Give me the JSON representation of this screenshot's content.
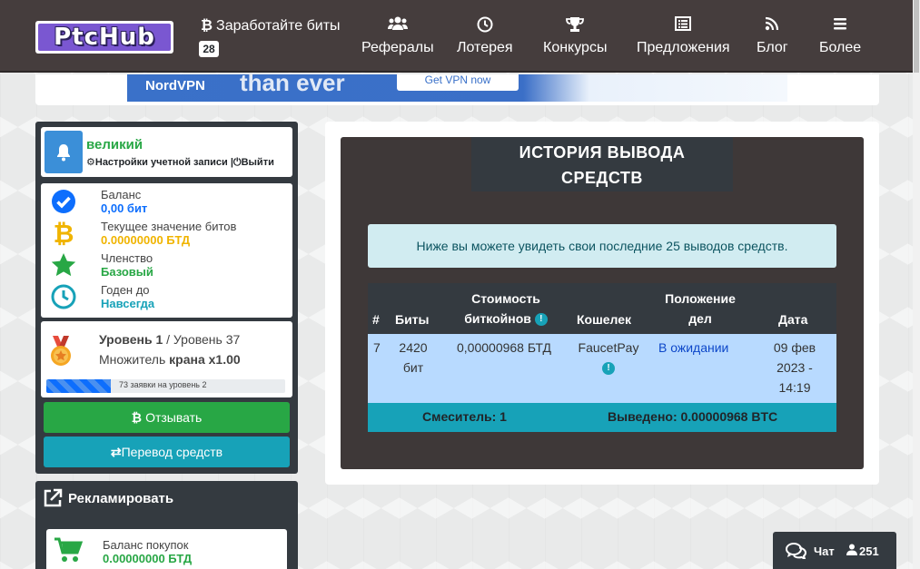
{
  "nav": {
    "logo": "PtcHub",
    "earn_label": "Заработайте биты",
    "earn_badge": "28",
    "items": [
      {
        "label": "Рефералы",
        "icon": "users-icon"
      },
      {
        "label": "Лотерея",
        "icon": "clock-icon"
      },
      {
        "label": "Конкурсы",
        "icon": "trophy-icon"
      },
      {
        "label": "Предложения",
        "icon": "list-icon"
      },
      {
        "label": "Блог",
        "icon": "rss-icon"
      },
      {
        "label": "Более",
        "icon": "menu-icon"
      }
    ]
  },
  "ad": {
    "brand": "NordVPN",
    "headline": "than ever",
    "button": "Get VPN now"
  },
  "user": {
    "name": "великий",
    "settings_link": "Настройки учетной записи",
    "logout_link": "Выйти"
  },
  "stats": {
    "balance_label": "Баланс",
    "balance_value": "0,00 бит",
    "bits_label": "Текущее значение битов",
    "bits_value": "0.00000000 БТД",
    "membership_label": "Членство",
    "membership_value": "Базовый",
    "valid_label": "Годен до",
    "valid_value": "Навсегда"
  },
  "level": {
    "current": "Уровень 1",
    "next": "Уровень 37",
    "multiplier_label": "Множитель",
    "multiplier_value": "крана x1.00",
    "progress_text": "73 заявки на уровень 2",
    "progress_fraction": 0.27
  },
  "buttons": {
    "withdraw": "Отзывать",
    "transfer": "Перевод средств"
  },
  "advertise": {
    "title": "Рекламировать",
    "balance_label": "Баланс покупок",
    "balance_value": "0.00000000 БТД"
  },
  "main": {
    "title_line1": "ИСТОРИЯ ВЫВОДА",
    "title_line2": "СРЕДСТВ",
    "info": "Ниже вы можете увидеть свои последние 25 выводов средств.",
    "headers": {
      "num": "#",
      "bits": "Биты",
      "cost_line1": "Стоимость",
      "cost_line2": "биткойнов",
      "wallet": "Кошелек",
      "status_line1": "Положение",
      "status_line2": "дел",
      "date": "Дата"
    },
    "row": {
      "num": "7",
      "bits_line1": "2420",
      "bits_line2": "бит",
      "cost": "0,00000968 БТД",
      "wallet": "FaucetPay",
      "status": "В ожидании",
      "date_line1": "09 фев",
      "date_line2": "2023 -",
      "date_line3": "14:19"
    },
    "footer": {
      "mixer": "Смеситель: 1",
      "withdrawn": "Выведено: 0.00000968 BTC"
    }
  },
  "chat": {
    "label": "Чат",
    "count": "251"
  },
  "colors": {
    "navbar": "#453d3d",
    "accent_green": "#28a745",
    "accent_blue": "#0d6efd",
    "accent_teal": "#17a2b8",
    "bits_yellow": "#f0b400"
  }
}
